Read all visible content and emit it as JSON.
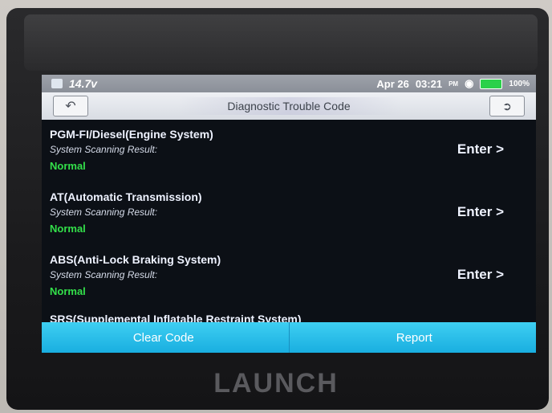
{
  "status_bar": {
    "voltage": "14.7v",
    "date": "Apr 26",
    "time": "03:21",
    "time_suffix": "PM",
    "battery": "100%"
  },
  "title_bar": {
    "title": "Diagnostic Trouble Code",
    "back_icon": "back-arrow-icon",
    "exit_icon": "exit-icon"
  },
  "systems": [
    {
      "name": "PGM-FI/Diesel(Engine System)",
      "result_label": "System Scanning Result:",
      "status": "Normal",
      "action": "Enter >"
    },
    {
      "name": "AT(Automatic Transmission)",
      "result_label": "System Scanning Result:",
      "status": "Normal",
      "action": "Enter >"
    },
    {
      "name": "ABS(Anti-Lock Braking System)",
      "result_label": "System Scanning Result:",
      "status": "Normal",
      "action": "Enter >"
    }
  ],
  "partial_item": "SRS(Supplemental Inflatable Restraint System)",
  "buttons": {
    "clear_code": "Clear Code",
    "report": "Report"
  },
  "device_brand": "LAUNCH",
  "colors": {
    "status_normal": "#33e04a",
    "button_accent": "#1fb8e8"
  }
}
